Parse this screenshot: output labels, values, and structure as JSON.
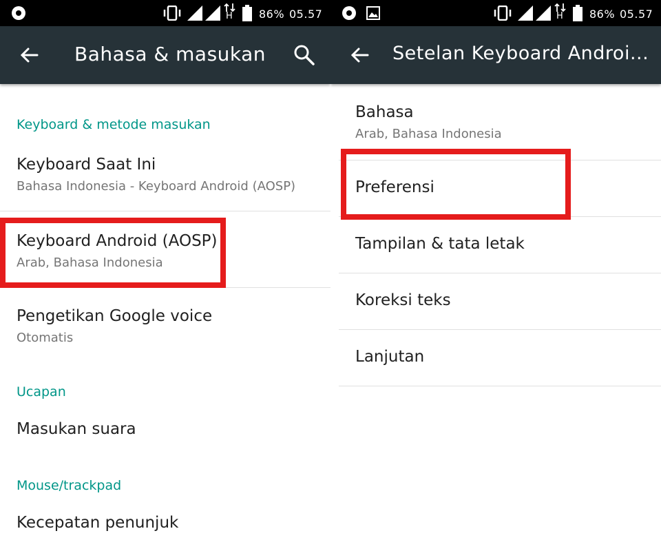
{
  "colors": {
    "appbar": "#263238",
    "statusbar": "#000000",
    "accent": "#009688",
    "highlight": "#e51c1c"
  },
  "left": {
    "statusbar": {
      "battery": "86%",
      "time": "05.57",
      "network": "H"
    },
    "appbar": {
      "title": "Bahasa & masukan",
      "back_icon": "arrow-back-icon",
      "search_icon": "search-icon"
    },
    "sections": [
      {
        "header": "Keyboard & metode masukan",
        "items": [
          {
            "title": "Keyboard Saat Ini",
            "subtitle": "Bahasa Indonesia - Keyboard Android (AOSP)"
          },
          {
            "title": "Keyboard Android (AOSP)",
            "subtitle": "Arab, Bahasa Indonesia",
            "highlighted": true
          },
          {
            "title": "Pengetikan Google voice",
            "subtitle": "Otomatis"
          }
        ]
      },
      {
        "header": "Ucapan",
        "items": [
          {
            "title": "Masukan suara"
          }
        ]
      },
      {
        "header": "Mouse/trackpad",
        "items": [
          {
            "title": "Kecepatan penunjuk"
          }
        ]
      }
    ]
  },
  "right": {
    "statusbar": {
      "battery": "86%",
      "time": "05.57",
      "network": "H"
    },
    "appbar": {
      "title": "Setelan Keyboard Androi...",
      "back_icon": "arrow-back-icon"
    },
    "items": [
      {
        "title": "Bahasa",
        "subtitle": "Arab, Bahasa Indonesia"
      },
      {
        "title": "Preferensi",
        "highlighted": true
      },
      {
        "title": "Tampilan & tata letak"
      },
      {
        "title": "Koreksi teks"
      },
      {
        "title": "Lanjutan"
      }
    ]
  }
}
